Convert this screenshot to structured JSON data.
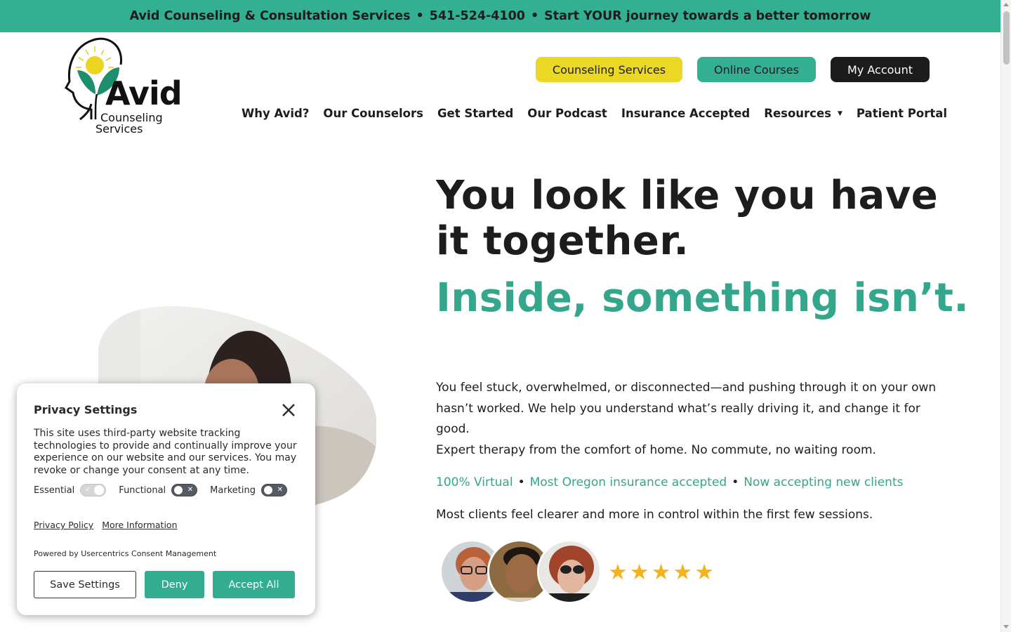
{
  "topbar": {
    "name": "Avid Counseling & Consultation Services",
    "phone": "541-524-4100",
    "tagline": "Start YOUR journey towards a better tomorrow",
    "separator": "•"
  },
  "logo": {
    "word": "Avid",
    "line1": "Counseling",
    "line2": "Services"
  },
  "header_buttons": {
    "counseling": "Counseling Services",
    "courses": "Online Courses",
    "account": "My Account"
  },
  "nav": [
    {
      "label": "Why Avid?"
    },
    {
      "label": "Our Counselors"
    },
    {
      "label": "Get Started"
    },
    {
      "label": "Our Podcast"
    },
    {
      "label": "Insurance Accepted"
    },
    {
      "label": "Resources",
      "caret": "▼"
    },
    {
      "label": "Patient Portal"
    }
  ],
  "hero": {
    "headline": "You look like you have it together.",
    "subheadline": "Inside, something isn’t.",
    "paragraph1": "You feel stuck, overwhelmed, or disconnected—and pushing through it on your own hasn’t worked. We help you understand what’s really driving it, and change it for good.",
    "paragraph2": "Expert therapy from the comfort of home. No commute, no waiting room.",
    "features": [
      "100% Virtual",
      "Most Oregon insurance accepted",
      "Now accepting new clients"
    ],
    "feature_separator": "•",
    "paragraph3": "Most clients feel clearer and more in control within the first few sessions.",
    "rating_stars": 5,
    "star_glyph": "★"
  },
  "privacy": {
    "title": "Privacy Settings",
    "text": "This site uses third-party website tracking technologies to provide and continually improve your experience on our website and our services. You may revoke or change your consent at any time.",
    "toggles": [
      {
        "label": "Essential",
        "state": "on"
      },
      {
        "label": "Functional",
        "state": "off"
      },
      {
        "label": "Marketing",
        "state": "off"
      }
    ],
    "link_policy": "Privacy Policy",
    "link_more": "More Information",
    "powered": "Powered by Usercentrics Consent Management",
    "btn_save": "Save Settings",
    "btn_deny": "Deny",
    "btn_accept": "Accept All"
  },
  "colors": {
    "brand_green": "#33b092",
    "brand_yellow": "#ead824",
    "dark": "#1c1c1c",
    "star": "#f6b21c"
  }
}
